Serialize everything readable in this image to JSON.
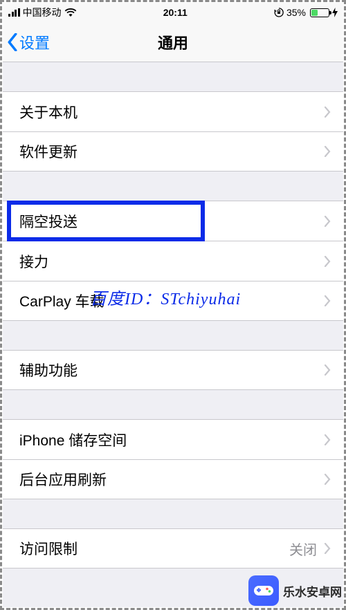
{
  "status": {
    "carrier": "中国移动",
    "time": "20:11",
    "battery_pct": "35%"
  },
  "nav": {
    "back_label": "设置",
    "title": "通用"
  },
  "groups": [
    {
      "cells": [
        {
          "label": "关于本机",
          "value": ""
        },
        {
          "label": "软件更新",
          "value": ""
        }
      ]
    },
    {
      "cells": [
        {
          "label": "隔空投送",
          "value": "",
          "highlight": true
        },
        {
          "label": "接力",
          "value": ""
        },
        {
          "label": "CarPlay 车载",
          "value": ""
        }
      ]
    },
    {
      "cells": [
        {
          "label": "辅助功能",
          "value": ""
        }
      ]
    },
    {
      "cells": [
        {
          "label": "iPhone 储存空间",
          "value": ""
        },
        {
          "label": "后台应用刷新",
          "value": ""
        }
      ]
    },
    {
      "cells": [
        {
          "label": "访问限制",
          "value": "关闭"
        }
      ]
    }
  ],
  "watermark": {
    "text": "百度ID：STchiyuhai",
    "logo_text": "乐水安卓网"
  }
}
